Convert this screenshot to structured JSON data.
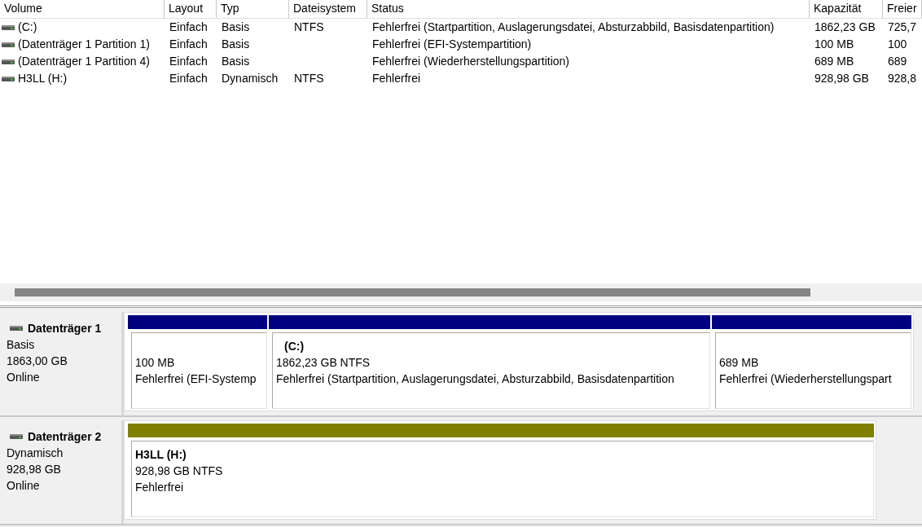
{
  "volume_table": {
    "columns": [
      "Volume",
      "Layout",
      "Typ",
      "Dateisystem",
      "Status",
      "Kapazität",
      "Freier"
    ],
    "rows": [
      {
        "cells": [
          "(C:)",
          "Einfach",
          "Basis",
          "NTFS",
          "Fehlerfrei (Startpartition, Auslagerungsdatei, Absturzabbild, Basisdatenpartition)",
          "1862,23 GB",
          "725,7"
        ]
      },
      {
        "cells": [
          "(Datenträger 1 Partition 1)",
          "Einfach",
          "Basis",
          "",
          "Fehlerfrei (EFI-Systempartition)",
          "100 MB",
          "100"
        ]
      },
      {
        "cells": [
          "(Datenträger 1 Partition 4)",
          "Einfach",
          "Basis",
          "",
          "Fehlerfrei (Wiederherstellungspartition)",
          "689 MB",
          "689"
        ]
      },
      {
        "cells": [
          "H3LL (H:)",
          "Einfach",
          "Dynamisch",
          "NTFS",
          "Fehlerfrei",
          "928,98 GB",
          "928,8"
        ]
      }
    ]
  },
  "disks": [
    {
      "name": "Datenträger 1",
      "type": "Basis",
      "size": "1863,00 GB",
      "state": "Online",
      "partitions": [
        {
          "size": "100 MB",
          "status": "Fehlerfrei (EFI-Systemp",
          "color": "#000080"
        },
        {
          "title": "(C:)",
          "size": "1862,23 GB NTFS",
          "status": "Fehlerfrei (Startpartition, Auslagerungsdatei, Absturzabbild, Basisdatenpartition",
          "color": "#000080"
        },
        {
          "size": "689 MB",
          "status": "Fehlerfrei (Wiederherstellungspart",
          "color": "#000080"
        }
      ]
    },
    {
      "name": "Datenträger 2",
      "type": "Dynamisch",
      "size": "928,98 GB",
      "state": "Online",
      "partitions": [
        {
          "title": "H3LL  (H:)",
          "size": "928,98 GB NTFS",
          "status": "Fehlerfrei",
          "color": "#808000"
        }
      ]
    }
  ]
}
